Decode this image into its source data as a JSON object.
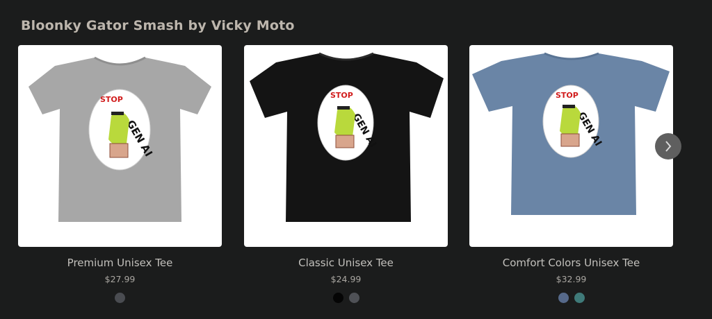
{
  "section": {
    "title": "Bloonky Gator Smash by Vicky Moto"
  },
  "design": {
    "word_stop": "STOP",
    "word_genai": "GEN AI"
  },
  "products": [
    {
      "name": "Premium Unisex Tee",
      "price": "$27.99",
      "shirt_color": "#a7a7a7",
      "swatches": [
        "#4a4c51"
      ]
    },
    {
      "name": "Classic Unisex Tee",
      "price": "$24.99",
      "shirt_color": "#141414",
      "swatches": [
        "#050505",
        "#4f5156"
      ]
    },
    {
      "name": "Comfort Colors Unisex Tee",
      "price": "$32.99",
      "shirt_color": "#6a85a6",
      "swatches": [
        "#56698a",
        "#3f7a79"
      ]
    }
  ],
  "carousel": {
    "next_icon": "chevron-right-icon"
  }
}
